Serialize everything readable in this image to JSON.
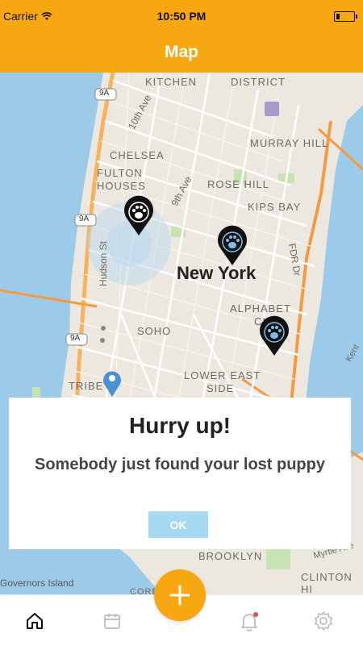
{
  "status_bar": {
    "carrier": "Carrier",
    "time": "10:50 PM"
  },
  "header": {
    "title": "Map"
  },
  "map": {
    "labels": {
      "kitchen": "KITCHEN",
      "district": "DISTRICT",
      "murray_hill": "MURRAY HILL",
      "chelsea": "CHELSEA",
      "fulton_houses_1": "FULTON",
      "fulton_houses_2": "HOUSES",
      "rose_hill": "ROSE HILL",
      "kips_bay": "KIPS BAY",
      "alphabet_1": "ALPHABET",
      "alphabet_2": "CITY",
      "soho": "SOHO",
      "lower_east_1": "LOWER EAST",
      "lower_east_2": "SIDE",
      "tribeca": "TRIBE",
      "brooklyn": "BROOKLYN",
      "clinton": "CLINTON HI",
      "governors": "Governors Island",
      "tenth_ave": "10th Ave",
      "ninth_ave": "9th Ave",
      "hudson_st": "Hudson St",
      "fdr": "FDR Dr",
      "kent": "Kent",
      "myrtle": "Myrtle Ave",
      "route_9a": "9A",
      "corbi": "CORBI"
    },
    "city": "New York"
  },
  "dialog": {
    "title": "Hurry up!",
    "message": "Somebody just found your lost puppy",
    "ok_label": "OK"
  },
  "tabbar": {
    "tabs": [
      "home-icon",
      "calendar-icon",
      "bell-icon",
      "gear-icon"
    ],
    "fab_icon": "plus-icon"
  },
  "colors": {
    "accent": "#f7a711",
    "button": "#a8d9f2",
    "pin": "#111111",
    "location_pin": "#4b8fd4",
    "water": "#9ccbe9"
  }
}
